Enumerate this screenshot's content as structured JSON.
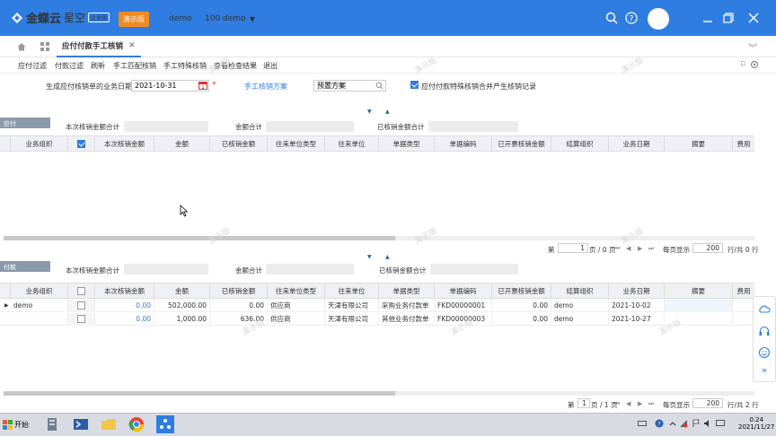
{
  "app": {
    "brand": "金蝶云",
    "brand_sub": "星空",
    "edition": "企业版",
    "demo_badge": "演示版",
    "user": "demo",
    "datacenter": "100  demo"
  },
  "tabs": [
    {
      "label": "应付付款手工核销"
    }
  ],
  "menu": [
    "应付过滤",
    "付款过滤",
    "刷新",
    "手工匹配核销",
    "手工特殊核销",
    "查看检查结果",
    "退出"
  ],
  "form": {
    "date_label": "生成应付核销单的业务日期",
    "date_value": "2021-10-31",
    "plan_label": "手工核销方案",
    "plan_value": "预置方案",
    "merge_label": "应付付款特殊核销合并产生核销记录"
  },
  "payable": {
    "tag": "应付",
    "sum_labels": [
      "本次核销金额合计",
      "金额合计",
      "已核销金额合计"
    ],
    "columns": [
      "业务组织",
      "",
      "本次核销金额",
      "金额",
      "已核销金额",
      "往来单位类型",
      "往来单位",
      "单据类型",
      "单据编码",
      "已开票核销金额",
      "结算组织",
      "业务日期",
      "摘要",
      "费用"
    ],
    "rows": [],
    "pager": {
      "page_prefix": "第",
      "page_value": "1",
      "page_suffix": "页 / 0 页",
      "per_page_label": "每页显示",
      "per_page": "200",
      "total_label": "行/共 0 行"
    }
  },
  "payment": {
    "tag": "付款",
    "sum_labels": [
      "本次核销金额合计",
      "金额合计",
      "已核销金额合计"
    ],
    "columns": [
      "业务组织",
      "",
      "本次核销金额",
      "金额",
      "已核销金额",
      "往来单位类型",
      "往来单位",
      "单据类型",
      "单据编码",
      "已开票核销金额",
      "结算组织",
      "业务日期",
      "摘要",
      "费用"
    ],
    "rows": [
      {
        "org": "demo",
        "this_amt": "0.00",
        "amount": "502,000.00",
        "verified": "0.00",
        "unit_type": "供应商",
        "unit": "天津有限公司",
        "doc_type": "采购业务付款单",
        "doc_no": "FKD00000001",
        "inv_verified": "0.00",
        "settle_org": "demo",
        "date": "2021-10-02",
        "memo": "",
        "fee": ""
      },
      {
        "org": "",
        "this_amt": "0.00",
        "amount": "1,000.00",
        "verified": "636.00",
        "unit_type": "供应商",
        "unit": "天津有限公司",
        "doc_type": "其他业务付款单",
        "doc_no": "FKD00000003",
        "inv_verified": "0.00",
        "settle_org": "demo",
        "date": "2021-10-27",
        "memo": "",
        "fee": ""
      }
    ],
    "pager": {
      "page_prefix": "第",
      "page_value": "1",
      "page_suffix": "页 / 1 页",
      "per_page_label": "每页显示",
      "per_page": "200",
      "total_label": "行/共 2 行"
    }
  },
  "watermark": "演示版",
  "taskbar": {
    "start_label": "开始",
    "time": "0:24",
    "date": "2021/11/27"
  },
  "colors": {
    "accent": "#2f7de1",
    "demo_badge": "#f08a24",
    "section_tag": "#8a9aac"
  }
}
